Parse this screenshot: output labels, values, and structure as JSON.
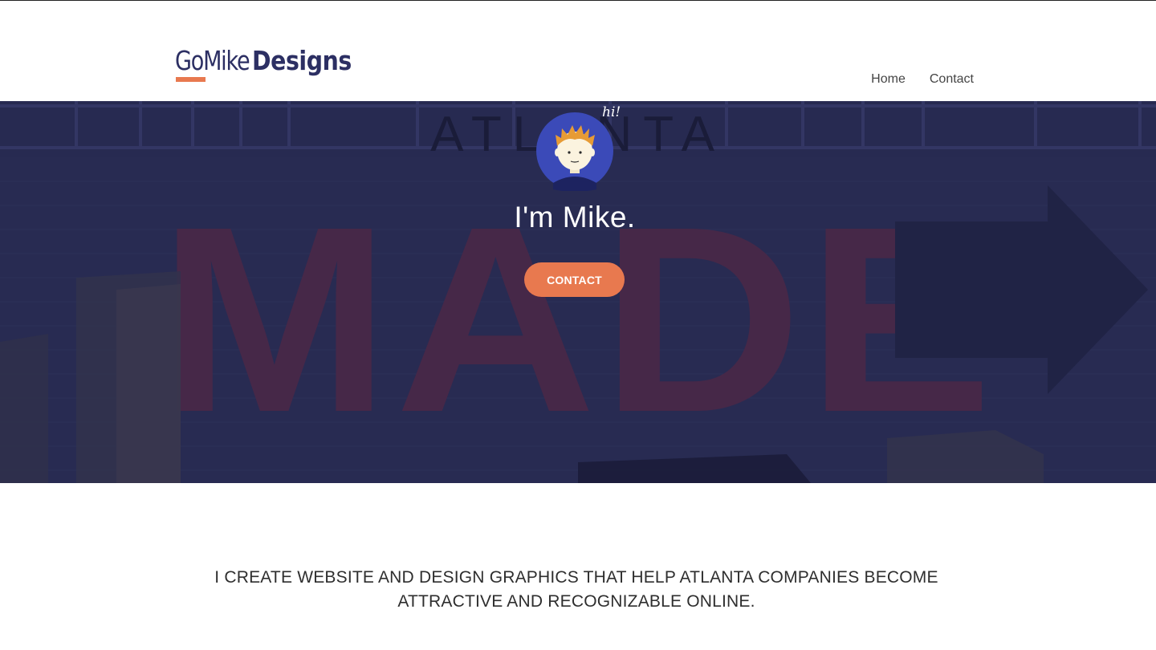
{
  "brand": {
    "logo_go_mike": "GoMike",
    "logo_designs": "Designs",
    "accent_color": "#e8794f",
    "navy_color": "#2c2f63"
  },
  "nav": {
    "items": [
      {
        "label": "Home"
      },
      {
        "label": "Contact"
      }
    ]
  },
  "hero": {
    "sign_atlanta": "ATLANTA",
    "sign_made": "MADE",
    "avatar_speech": "hi!",
    "title": "I'm Mike.",
    "button_label": "CONTACT"
  },
  "tagline": "I create website and design graphics that help Atlanta companies become attractive and recognizable online."
}
